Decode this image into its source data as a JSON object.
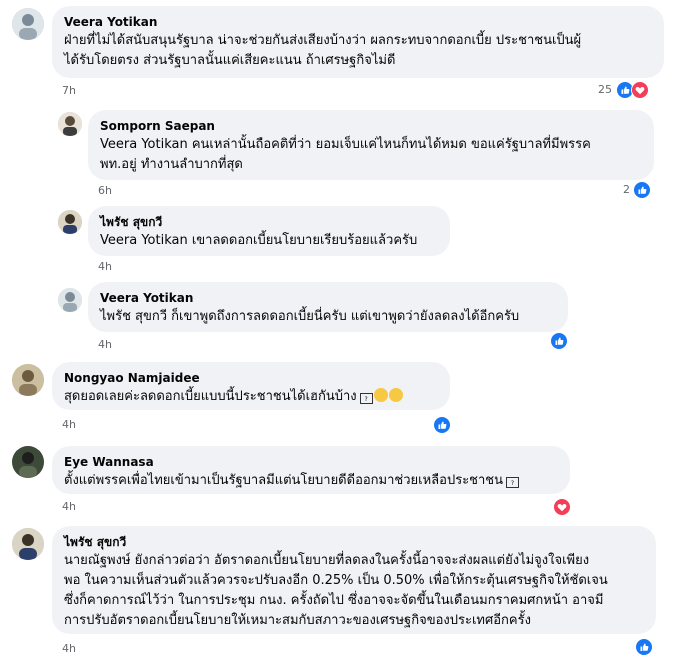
{
  "colors": {
    "bubble": "#f0f2f5",
    "like_blue": "#1877f2",
    "love_red": "#f33e58",
    "meta_gray": "#65676b"
  },
  "comments": [
    {
      "author": "Veera Yotikan",
      "text_lines": [
        "ฝ่ายที่ไม่ได้สนับสนุนรัฐบาล น่าจะช่วยกันส่งเสียงบ้างว่า ผลกระทบจากดอกเบี้ย ประชาชนเป็นผู้",
        "ได้รับโดยตรง ส่วนรัฐบาลนั้นแค่เสียคะแนน ถ้าเศรษฐกิจไม่ดี"
      ],
      "time": "7h",
      "reaction_count": "25",
      "reactions": [
        "like-icon",
        "love-icon"
      ]
    },
    {
      "author": "Somporn Saepan",
      "text_lines": [
        "Veera Yotikan คนเหล่านั้นถือคติที่ว่า ยอมเจ็บแค่ไหนก็ทนได้หมด ขอแค่รัฐบาลที่มีพรรค",
        "พท.อยู่ ทำงานลำบากที่สุด"
      ],
      "time": "6h",
      "reaction_count": "2",
      "reactions": [
        "like-icon"
      ]
    },
    {
      "author": "ไพรัช สุขกวี",
      "text_lines": [
        "Veera Yotikan เขาลดดอกเบี้ยนโยบายเรียบร้อยแล้วครับ"
      ],
      "time": "4h",
      "reaction_count": "",
      "reactions": []
    },
    {
      "author": "Veera Yotikan",
      "text_lines": [
        "ไพรัช สุขกวี ก็เขาพูดถึงการลดดอกเบี้ยนี่ครับ แต่เขาพูดว่ายังลดลงได้อีกครับ"
      ],
      "time": "4h",
      "reaction_count": "",
      "reactions": [
        "like-icon"
      ]
    },
    {
      "author": "Nongyao Namjaidee",
      "text_lines": [
        "สุดยอดเลยค่ะลดดอกเบี้ยแบบนี้ประชาชนได้เฮกันบ้าง"
      ],
      "emojis": [
        "unknown-emoji-box",
        "smiling-hearts-emoji",
        "smiling-hearts-emoji"
      ],
      "time": "4h",
      "reaction_count": "",
      "reactions": [
        "like-icon"
      ]
    },
    {
      "author": "Eye Wannasa",
      "text_lines": [
        "ตั้งแต่พรรคเพื่อไทยเข้ามาเป็นรัฐบาลมีแต่นโยบายดีดีออกมาช่วยเหลือประชาชน"
      ],
      "emojis": [
        "unknown-emoji-box"
      ],
      "time": "4h",
      "reaction_count": "",
      "reactions": [
        "love-icon"
      ]
    },
    {
      "author": "ไพรัช สุขกวี",
      "text_lines": [
        "นายณัฐพงษ์ ยังกล่าวต่อว่า อัตราดอกเบี้ยนโยบายที่ลดลงในครั้งนี้อาจจะส่งผลแต่ยังไม่จูงใจเพียง",
        "พอ ในความเห็นส่วนตัวแล้วควรจะปรับลงอีก 0.25% เป็น 0.50% เพื่อให้กระตุ้นเศรษฐกิจให้ชัดเจน",
        "ซึ่งก็คาดการณ์ไว้ว่า ในการประชุม กนง. ครั้งถัดไป ซึ่งอาจจะจัดขึ้นในเดือนมกราคมศกหน้า อาจมี",
        "การปรับอัตราดอกเบี้ยนโยบายให้เหมาะสมกับสภาวะของเศรษฐกิจของประเทศอีกครั้ง"
      ],
      "time": "4h",
      "reaction_count": "",
      "reactions": [
        "like-icon"
      ]
    }
  ]
}
